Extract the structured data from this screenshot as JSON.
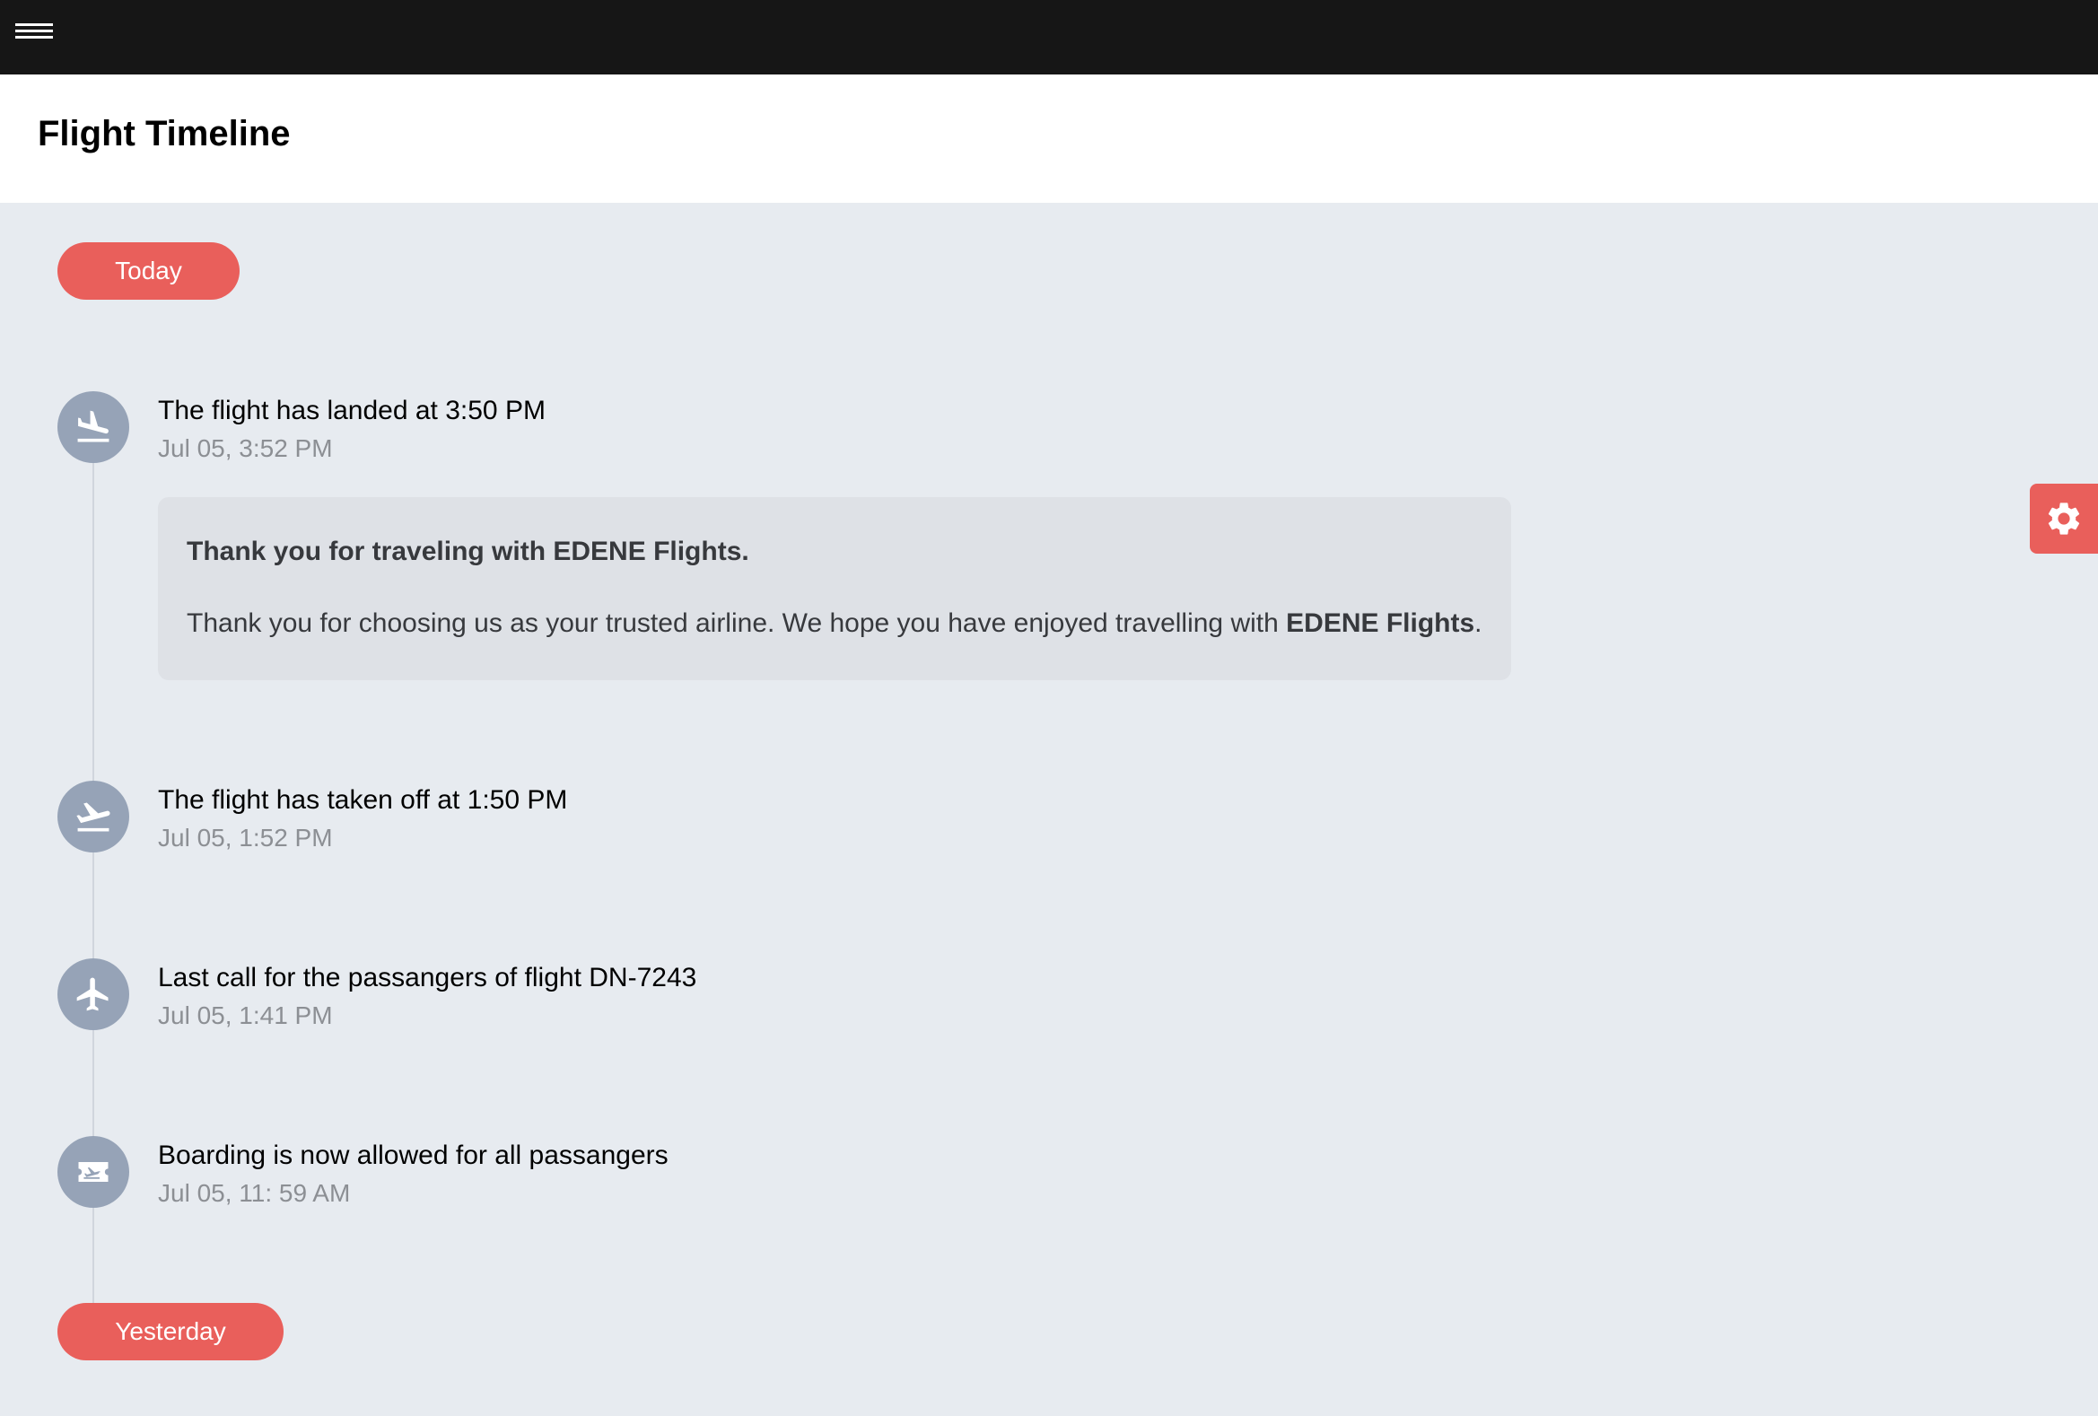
{
  "topbar": {
    "menu_icon": "hamburger-menu-icon"
  },
  "header": {
    "title": "Flight Timeline"
  },
  "groups": {
    "today": "Today",
    "yesterday": "Yesterday"
  },
  "events": [
    {
      "icon": "plane-landing-icon",
      "title": "The flight has landed at 3:50 PM",
      "time": "Jul 05, 3:52 PM",
      "message": {
        "heading": "Thank you for traveling with EDENE Flights.",
        "body_prefix": "Thank you for choosing us as your trusted airline. We hope you have enjoyed travelling with ",
        "body_bold": "EDENE Flights",
        "body_suffix": "."
      }
    },
    {
      "icon": "plane-departure-icon",
      "title": "The flight has taken off at 1:50 PM",
      "time": "Jul 05, 1:52 PM"
    },
    {
      "icon": "airplane-icon",
      "title": "Last call for the passangers of flight DN-7243",
      "time": "Jul 05, 1:41 PM"
    },
    {
      "icon": "boarding-ticket-icon",
      "title": "Boarding is now allowed for all passangers",
      "time": "Jul 05, 11: 59 AM"
    }
  ],
  "settings": {
    "icon": "gear-icon"
  },
  "colors": {
    "topbar": "#161616",
    "accent": "#e95f5b",
    "background": "#e7ebf0",
    "icon_circle": "#96a3b7",
    "card": "#dee1e6"
  }
}
